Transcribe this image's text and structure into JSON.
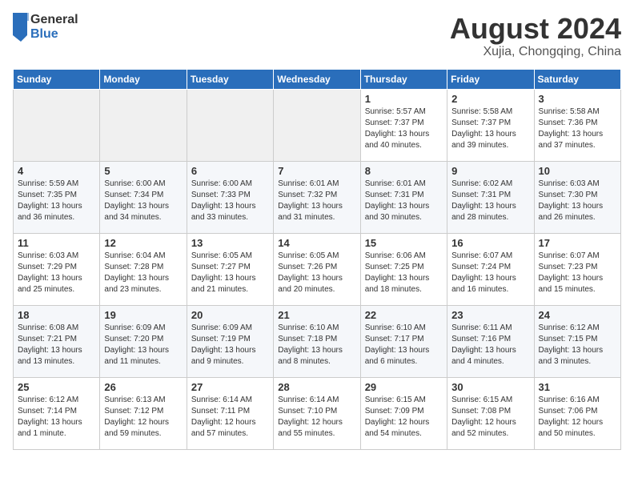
{
  "header": {
    "logo_general": "General",
    "logo_blue": "Blue",
    "month_title": "August 2024",
    "location": "Xujia, Chongqing, China"
  },
  "weekdays": [
    "Sunday",
    "Monday",
    "Tuesday",
    "Wednesday",
    "Thursday",
    "Friday",
    "Saturday"
  ],
  "weeks": [
    [
      {
        "day": "",
        "info": ""
      },
      {
        "day": "",
        "info": ""
      },
      {
        "day": "",
        "info": ""
      },
      {
        "day": "",
        "info": ""
      },
      {
        "day": "1",
        "info": "Sunrise: 5:57 AM\nSunset: 7:37 PM\nDaylight: 13 hours\nand 40 minutes."
      },
      {
        "day": "2",
        "info": "Sunrise: 5:58 AM\nSunset: 7:37 PM\nDaylight: 13 hours\nand 39 minutes."
      },
      {
        "day": "3",
        "info": "Sunrise: 5:58 AM\nSunset: 7:36 PM\nDaylight: 13 hours\nand 37 minutes."
      }
    ],
    [
      {
        "day": "4",
        "info": "Sunrise: 5:59 AM\nSunset: 7:35 PM\nDaylight: 13 hours\nand 36 minutes."
      },
      {
        "day": "5",
        "info": "Sunrise: 6:00 AM\nSunset: 7:34 PM\nDaylight: 13 hours\nand 34 minutes."
      },
      {
        "day": "6",
        "info": "Sunrise: 6:00 AM\nSunset: 7:33 PM\nDaylight: 13 hours\nand 33 minutes."
      },
      {
        "day": "7",
        "info": "Sunrise: 6:01 AM\nSunset: 7:32 PM\nDaylight: 13 hours\nand 31 minutes."
      },
      {
        "day": "8",
        "info": "Sunrise: 6:01 AM\nSunset: 7:31 PM\nDaylight: 13 hours\nand 30 minutes."
      },
      {
        "day": "9",
        "info": "Sunrise: 6:02 AM\nSunset: 7:31 PM\nDaylight: 13 hours\nand 28 minutes."
      },
      {
        "day": "10",
        "info": "Sunrise: 6:03 AM\nSunset: 7:30 PM\nDaylight: 13 hours\nand 26 minutes."
      }
    ],
    [
      {
        "day": "11",
        "info": "Sunrise: 6:03 AM\nSunset: 7:29 PM\nDaylight: 13 hours\nand 25 minutes."
      },
      {
        "day": "12",
        "info": "Sunrise: 6:04 AM\nSunset: 7:28 PM\nDaylight: 13 hours\nand 23 minutes."
      },
      {
        "day": "13",
        "info": "Sunrise: 6:05 AM\nSunset: 7:27 PM\nDaylight: 13 hours\nand 21 minutes."
      },
      {
        "day": "14",
        "info": "Sunrise: 6:05 AM\nSunset: 7:26 PM\nDaylight: 13 hours\nand 20 minutes."
      },
      {
        "day": "15",
        "info": "Sunrise: 6:06 AM\nSunset: 7:25 PM\nDaylight: 13 hours\nand 18 minutes."
      },
      {
        "day": "16",
        "info": "Sunrise: 6:07 AM\nSunset: 7:24 PM\nDaylight: 13 hours\nand 16 minutes."
      },
      {
        "day": "17",
        "info": "Sunrise: 6:07 AM\nSunset: 7:23 PM\nDaylight: 13 hours\nand 15 minutes."
      }
    ],
    [
      {
        "day": "18",
        "info": "Sunrise: 6:08 AM\nSunset: 7:21 PM\nDaylight: 13 hours\nand 13 minutes."
      },
      {
        "day": "19",
        "info": "Sunrise: 6:09 AM\nSunset: 7:20 PM\nDaylight: 13 hours\nand 11 minutes."
      },
      {
        "day": "20",
        "info": "Sunrise: 6:09 AM\nSunset: 7:19 PM\nDaylight: 13 hours\nand 9 minutes."
      },
      {
        "day": "21",
        "info": "Sunrise: 6:10 AM\nSunset: 7:18 PM\nDaylight: 13 hours\nand 8 minutes."
      },
      {
        "day": "22",
        "info": "Sunrise: 6:10 AM\nSunset: 7:17 PM\nDaylight: 13 hours\nand 6 minutes."
      },
      {
        "day": "23",
        "info": "Sunrise: 6:11 AM\nSunset: 7:16 PM\nDaylight: 13 hours\nand 4 minutes."
      },
      {
        "day": "24",
        "info": "Sunrise: 6:12 AM\nSunset: 7:15 PM\nDaylight: 13 hours\nand 3 minutes."
      }
    ],
    [
      {
        "day": "25",
        "info": "Sunrise: 6:12 AM\nSunset: 7:14 PM\nDaylight: 13 hours\nand 1 minute."
      },
      {
        "day": "26",
        "info": "Sunrise: 6:13 AM\nSunset: 7:12 PM\nDaylight: 12 hours\nand 59 minutes."
      },
      {
        "day": "27",
        "info": "Sunrise: 6:14 AM\nSunset: 7:11 PM\nDaylight: 12 hours\nand 57 minutes."
      },
      {
        "day": "28",
        "info": "Sunrise: 6:14 AM\nSunset: 7:10 PM\nDaylight: 12 hours\nand 55 minutes."
      },
      {
        "day": "29",
        "info": "Sunrise: 6:15 AM\nSunset: 7:09 PM\nDaylight: 12 hours\nand 54 minutes."
      },
      {
        "day": "30",
        "info": "Sunrise: 6:15 AM\nSunset: 7:08 PM\nDaylight: 12 hours\nand 52 minutes."
      },
      {
        "day": "31",
        "info": "Sunrise: 6:16 AM\nSunset: 7:06 PM\nDaylight: 12 hours\nand 50 minutes."
      }
    ]
  ]
}
